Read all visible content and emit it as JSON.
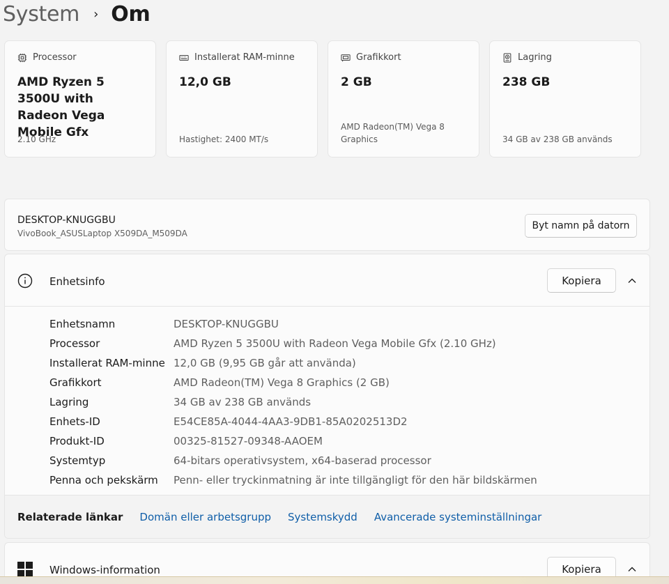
{
  "breadcrumb": {
    "parent": "System",
    "separator": "›",
    "current": "Om"
  },
  "cards": [
    {
      "icon": "processor-icon",
      "label": "Processor",
      "value": "AMD Ryzen 5 3500U with Radeon Vega Mobile Gfx",
      "sub": "2.10 GHz"
    },
    {
      "icon": "ram-icon",
      "label": "Installerat RAM-minne",
      "value": "12,0 GB",
      "sub": "Hastighet: 2400 MT/s"
    },
    {
      "icon": "graphics-card-icon",
      "label": "Grafikkort",
      "value": "2 GB",
      "sub": "AMD Radeon(TM) Vega 8 Graphics"
    },
    {
      "icon": "storage-icon",
      "label": "Lagring",
      "value": "238 GB",
      "sub": "34 GB av 238 GB används"
    }
  ],
  "pc": {
    "name": "DESKTOP-KNUGGBU",
    "model": "VivoBook_ASUSLaptop X509DA_M509DA",
    "rename_label": "Byt namn på datorn"
  },
  "device_info": {
    "title": "Enhetsinfo",
    "copy_label": "Kopiera",
    "rows": [
      {
        "label": "Enhetsnamn",
        "value": "DESKTOP-KNUGGBU"
      },
      {
        "label": "Processor",
        "value": "AMD Ryzen 5 3500U with Radeon Vega Mobile Gfx (2.10 GHz)"
      },
      {
        "label": "Installerat RAM-minne",
        "value": "12,0 GB (9,95 GB går att använda)"
      },
      {
        "label": "Grafikkort",
        "value": "AMD Radeon(TM) Vega 8 Graphics (2 GB)"
      },
      {
        "label": "Lagring",
        "value": "34 GB av 238 GB används"
      },
      {
        "label": "Enhets-ID",
        "value": "E54CE85A-4044-4AA3-9DB1-85A0202513D2"
      },
      {
        "label": "Produkt-ID",
        "value": "00325-81527-09348-AAOEM"
      },
      {
        "label": "Systemtyp",
        "value": "64-bitars operativsystem, x64-baserad processor"
      },
      {
        "label": "Penna och pekskärm",
        "value": "Penn- eller tryckinmatning är inte tillgängligt för den här bildskärmen"
      }
    ]
  },
  "related": {
    "label": "Relaterade länkar",
    "links": [
      "Domän eller arbetsgrupp",
      "Systemskydd",
      "Avancerade systeminställningar"
    ]
  },
  "windows_info": {
    "title": "Windows-information",
    "copy_label": "Kopiera"
  },
  "colors": {
    "link": "#0f5ea8",
    "card_bg": "#fbfbfb",
    "page_bg": "#f3f3f3"
  }
}
